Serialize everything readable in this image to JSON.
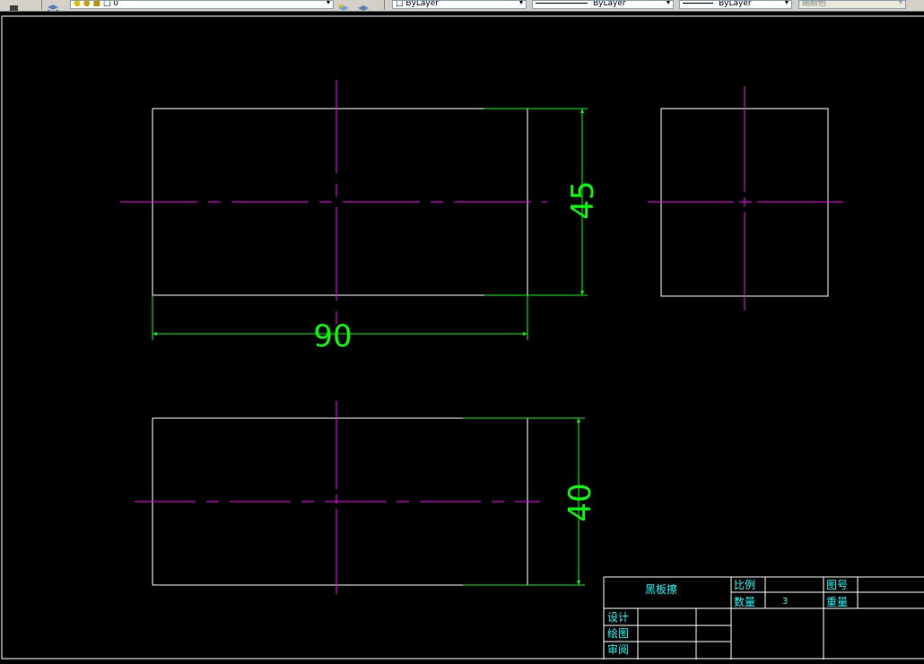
{
  "toolbar": {
    "layer_name": "0",
    "color_value": "ByLayer",
    "linetype_value": "ByLayer",
    "lineweight_value": "ByLayer",
    "plotstyle_value": "随颜色"
  },
  "dimensions": {
    "front_width": "90",
    "front_height": "45",
    "top_height": "40"
  },
  "title_block": {
    "part_name": "黑板擦",
    "scale_label": "比例",
    "drawing_no_label": "图号",
    "quantity_label": "数量",
    "quantity_value": "3",
    "weight_label": "重量",
    "design_label": "设计",
    "drafting_label": "绘图",
    "review_label": "审阅"
  },
  "colors": {
    "background": "#000000",
    "outline": "#ffffff",
    "centerline": "#ff00ff",
    "dimension": "#00ff00",
    "title_text": "#00ffff"
  }
}
